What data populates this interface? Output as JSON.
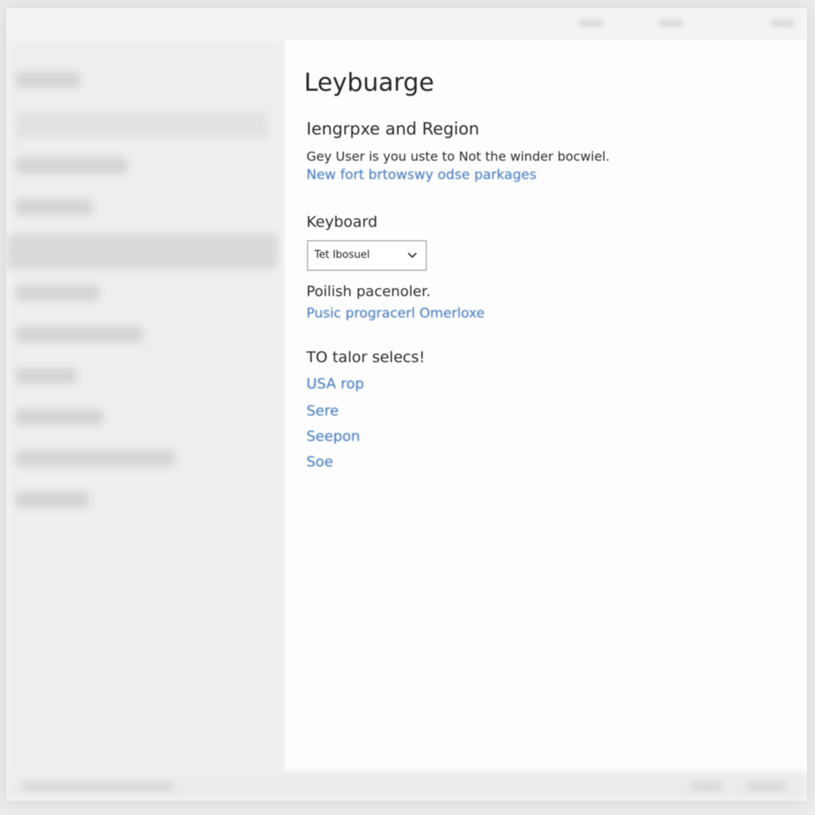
{
  "content": {
    "page_title": "Leybuarge",
    "language_region": {
      "heading": "Iengrpxe and Region",
      "description": "Gey User is you uste to Not the winder bocwiel.",
      "link": "New fort brtowswy odse parkages"
    },
    "keyboard": {
      "heading": "Keyboard",
      "selected_value": "Tet Ibosuel",
      "label": "Poilish pacenoler.",
      "link": "Pusic progracerl Omerloxe"
    },
    "tailor": {
      "heading": "TO talor selecs!",
      "options": [
        "USA rop",
        "Sere",
        "Seepon",
        "Soe"
      ]
    }
  },
  "colors": {
    "link": "#3c74b9",
    "text": "#2a2a2a",
    "content_bg": "#fdfdfd",
    "sidebar_bg": "#eeeeee"
  },
  "icons": {
    "dropdown": "chevron-down-icon"
  }
}
